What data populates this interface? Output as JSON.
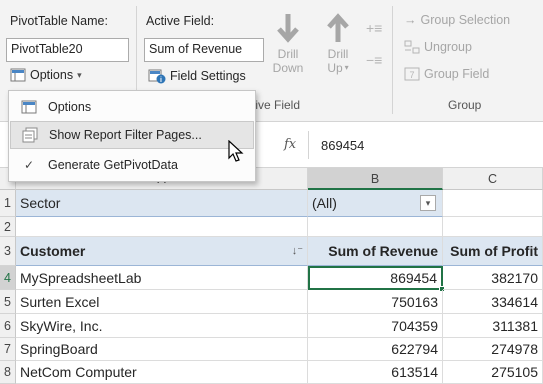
{
  "ribbon": {
    "pivot_name_label": "PivotTable Name:",
    "pivot_name_value": "PivotTable20",
    "options_label": "Options",
    "active_field_label": "Active Field:",
    "active_field_value": "Sum of Revenue",
    "field_settings_label": "Field Settings",
    "active_field_group": "Active Field",
    "drill_down": [
      "Drill",
      "Down"
    ],
    "drill_up": [
      "Drill",
      "Up"
    ],
    "group_selection": "Group Selection",
    "ungroup": "Ungroup",
    "group_field": "Group Field",
    "group_label": "Group"
  },
  "menu": {
    "items": [
      {
        "label": "Options",
        "icon": "options-icon"
      },
      {
        "label": "Show Report Filter Pages...",
        "icon": "report-filter-icon"
      },
      {
        "label": "Generate GetPivotData",
        "icon": "checkmark-icon",
        "checked": true
      }
    ]
  },
  "formula_bar": {
    "fx": "fx",
    "value": "869454"
  },
  "sheet": {
    "columns": [
      "A",
      "B",
      "C"
    ],
    "rows": [
      {
        "n": "1",
        "a": "Sector",
        "b": "(All)",
        "c": ""
      },
      {
        "n": "2",
        "a": "",
        "b": "",
        "c": ""
      },
      {
        "n": "3",
        "a": "Customer",
        "b": "Sum of Revenue",
        "c": "Sum of Profit"
      },
      {
        "n": "4",
        "a": "MySpreadsheetLab",
        "b": "869454",
        "c": "382170"
      },
      {
        "n": "5",
        "a": "Surten Excel",
        "b": "750163",
        "c": "334614"
      },
      {
        "n": "6",
        "a": "SkyWire, Inc.",
        "b": "704359",
        "c": "311381"
      },
      {
        "n": "7",
        "a": "SpringBoard",
        "b": "622794",
        "c": "274978"
      },
      {
        "n": "8",
        "a": "NetCom Computer",
        "b": "613514",
        "c": "275105"
      }
    ]
  },
  "colors": {
    "ribbon_bg": "#f3f3f3",
    "selection": "#217346",
    "pivot_header": "#dce6f1"
  }
}
